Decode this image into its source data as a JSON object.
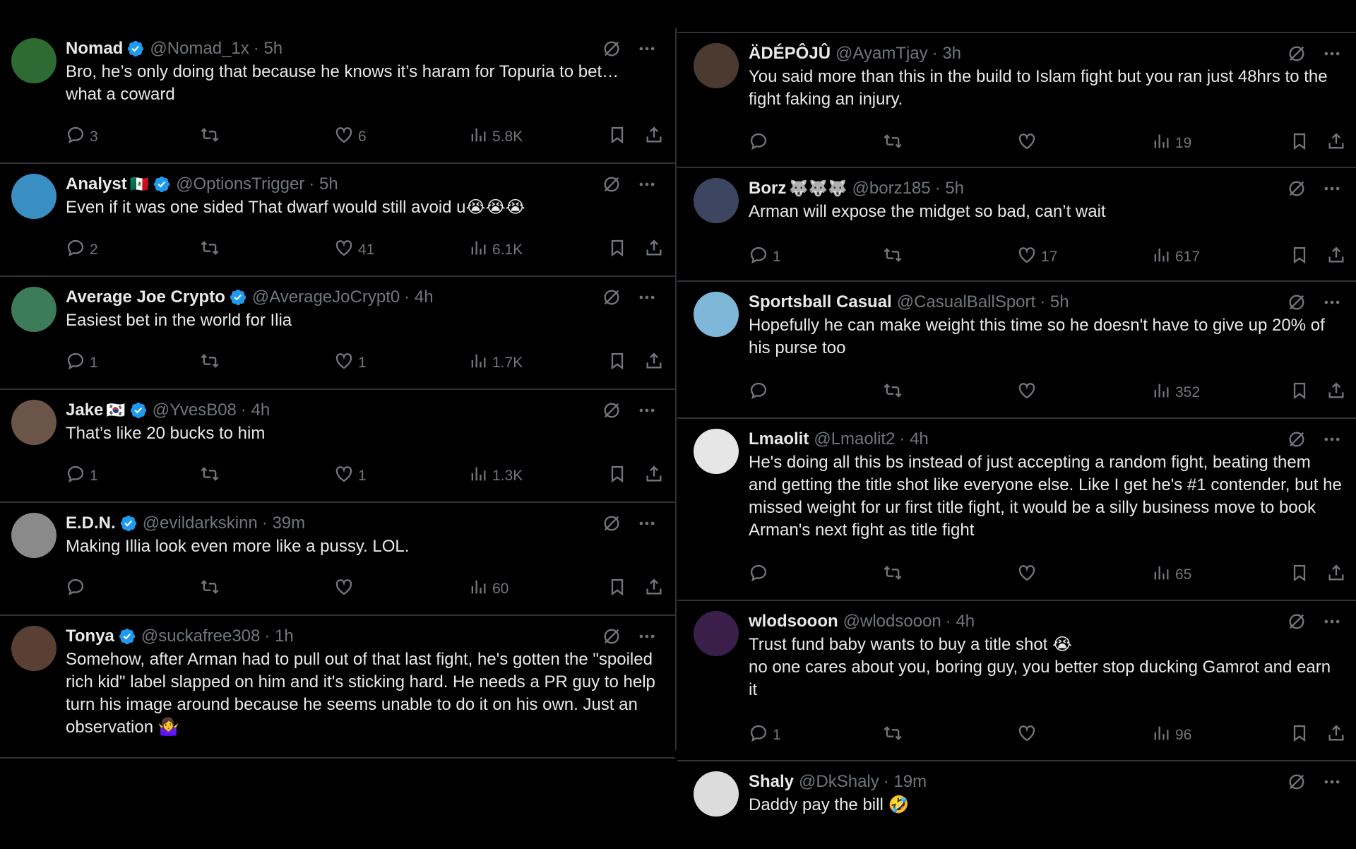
{
  "left_tweets": [
    {
      "name": "Nomad",
      "flag": "",
      "verified": true,
      "handle": "@Nomad_1x",
      "time": "· 5h",
      "text": "Bro, he’s only doing that because he knows it’s haram for Topuria to bet… what a coward",
      "replies": "3",
      "retweets": "",
      "likes": "6",
      "views": "5.8K",
      "avatar_color": "#2e6b33"
    },
    {
      "name": "Analyst",
      "flag": "🇲🇽",
      "verified": true,
      "handle": "@OptionsTrigger",
      "time": "· 5h",
      "text": "Even if it was one sided That dwarf would still avoid u😭😭😭",
      "replies": "2",
      "retweets": "",
      "likes": "41",
      "views": "6.1K",
      "avatar_color": "#3a8fc2"
    },
    {
      "name": "Average Joe Crypto",
      "flag": "",
      "verified": true,
      "handle": "@AverageJoCrypt0",
      "time": "· 4h",
      "text": "Easiest bet in the world for Ilia",
      "replies": "1",
      "retweets": "",
      "likes": "1",
      "views": "1.7K",
      "avatar_color": "#3c7c5a"
    },
    {
      "name": "Jake",
      "flag": "🇰🇷",
      "verified": true,
      "handle": "@YvesB08",
      "time": "· 4h",
      "text": "That’s like 20 bucks to him",
      "replies": "1",
      "retweets": "",
      "likes": "1",
      "views": "1.3K",
      "avatar_color": "#6b5448"
    },
    {
      "name": "E.D.N.",
      "flag": "",
      "verified": true,
      "handle": "@evildarkskinn",
      "time": "· 39m",
      "text": "Making Illia look even more like a pussy. LOL.",
      "replies": "",
      "retweets": "",
      "likes": "",
      "views": "60",
      "avatar_color": "#8a8a8a"
    },
    {
      "name": "Tonya",
      "flag": "",
      "verified": true,
      "handle": "@suckafree308",
      "time": "· 1h",
      "text": "Somehow, after Arman had to pull out of that last fight, he's gotten the \"spoiled rich kid\" label slapped on him and it's sticking hard.  He needs a PR guy to help turn his image around because he seems unable to do it on his own.  Just an observation 🤷‍♀️",
      "replies": "",
      "retweets": "",
      "likes": "",
      "views": "",
      "avatar_color": "#5a4034"
    }
  ],
  "right_tweets": [
    {
      "name": "ÄDÉPÔJÛ",
      "flag": "",
      "verified": false,
      "handle": "@AyamTjay",
      "time": "· 3h",
      "text": "You said more than this in the build to Islam fight but you ran just 48hrs to the fight faking an injury.",
      "replies": "",
      "retweets": "",
      "likes": "",
      "views": "19",
      "avatar_color": "#4a3a30"
    },
    {
      "name": "Borz",
      "flag": "🐺🐺🐺",
      "verified": false,
      "handle": "@borz185",
      "time": "· 5h",
      "text": "Arman will expose the midget so bad, can’t wait",
      "replies": "1",
      "retweets": "",
      "likes": "17",
      "views": "617",
      "avatar_color": "#3c4660"
    },
    {
      "name": "Sportsball Casual",
      "flag": "",
      "verified": false,
      "handle": "@CasualBallSport",
      "time": "· 5h",
      "text": "Hopefully he can make weight this time so he doesn't have to give up 20% of his purse too",
      "replies": "",
      "retweets": "",
      "likes": "",
      "views": "352",
      "avatar_color": "#7fb7d9"
    },
    {
      "name": "Lmaolit",
      "flag": "",
      "verified": false,
      "handle": "@Lmaolit2",
      "time": "· 4h",
      "text": "He's doing all this bs instead of just accepting a random fight, beating them and getting the title shot like everyone else. Like I get he's #1 contender, but he missed weight for ur first title fight, it would be a silly business move to book Arman's next fight as title fight",
      "replies": "",
      "retweets": "",
      "likes": "",
      "views": "65",
      "avatar_color": "#e6e6e6"
    },
    {
      "name": "wlodsooon",
      "flag": "",
      "verified": false,
      "handle": "@wlodsooon",
      "time": "· 4h",
      "text": "Trust fund baby wants to buy a title shot 😭\nno one cares about you, boring guy, you better stop ducking Gamrot and earn it",
      "replies": "1",
      "retweets": "",
      "likes": "",
      "views": "96",
      "avatar_color": "#3a1f4a"
    },
    {
      "name": "Shaly",
      "flag": "",
      "verified": false,
      "handle": "@DkShaly",
      "time": "· 19m",
      "text": "Daddy pay the bill 🤣",
      "replies": "",
      "retweets": "",
      "likes": "",
      "views": "",
      "avatar_color": "#dcdcdc"
    }
  ],
  "colors": {
    "background": "#000000",
    "text": "#e7e9ea",
    "muted": "#71767b",
    "divider": "#2f3336",
    "verified": "#1d9bf0"
  }
}
